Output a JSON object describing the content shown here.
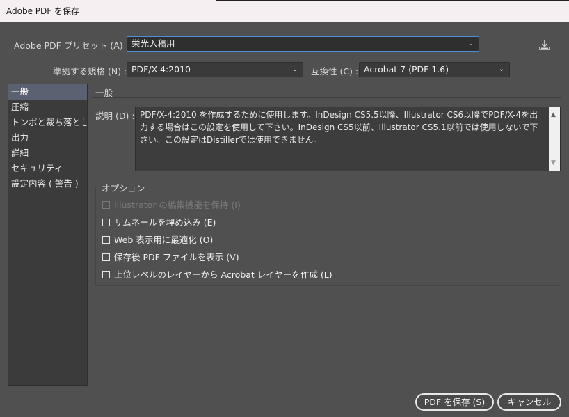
{
  "window": {
    "title": "Adobe PDF を保存"
  },
  "preset": {
    "label": "Adobe PDF プリセット (A) :",
    "value": "栄光入稿用"
  },
  "standard": {
    "label": "準拠する規格 (N) :",
    "value": "PDF/X-4:2010"
  },
  "compat": {
    "label": "互換性 (C) :",
    "value": "Acrobat 7 (PDF 1.6)"
  },
  "sidebar": {
    "items": [
      {
        "label": "一般"
      },
      {
        "label": "圧縮"
      },
      {
        "label": "トンボと裁ち落とし"
      },
      {
        "label": "出力"
      },
      {
        "label": "詳細"
      },
      {
        "label": "セキュリティ"
      },
      {
        "label": "設定内容 ( 警告 )"
      }
    ]
  },
  "general": {
    "heading": "一般",
    "description_label": "説明 (D) :",
    "description": "PDF/X-4:2010 を作成するために使用します。InDesign CS5.5以降、Illustrator CS6以降でPDF/X-4を出力する場合はこの設定を使用して下さい。InDesign CS5以前、Illustrator CS5.1以前では使用しないで下さい。この設定はDistillerでは使用できません。"
  },
  "options": {
    "legend": "オプション",
    "items": [
      {
        "label": "Illustrator の編集機能を保持 (I)",
        "checked": false,
        "disabled": true
      },
      {
        "label": "サムネールを埋め込み (E)",
        "checked": false,
        "disabled": false
      },
      {
        "label": "Web 表示用に最適化 (O)",
        "checked": false,
        "disabled": false
      },
      {
        "label": "保存後 PDF ファイルを表示 (V)",
        "checked": false,
        "disabled": false
      },
      {
        "label": "上位レベルのレイヤーから Acrobat レイヤーを作成 (L)",
        "checked": false,
        "disabled": false
      }
    ]
  },
  "buttons": {
    "save": "PDF を保存 (S)",
    "cancel": "キャンセル"
  },
  "colors": {
    "accent_focus": "#4a8fd8",
    "dialog_bg": "#505050",
    "selected_item": "#5a6272"
  }
}
